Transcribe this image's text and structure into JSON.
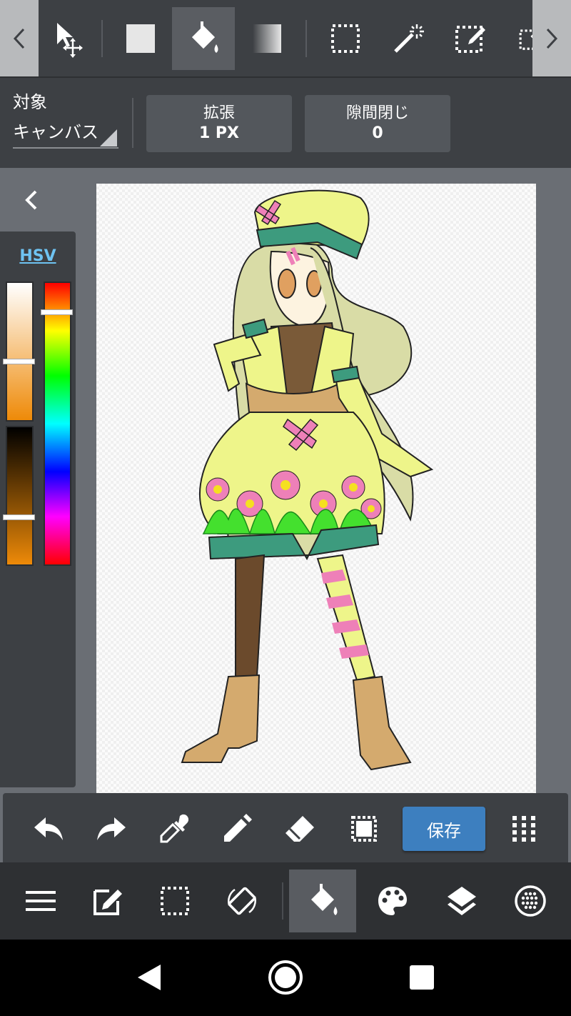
{
  "top_toolbar": {
    "tools": [
      "move-tool",
      "fill-color-tool",
      "bucket-fill-tool",
      "gradient-tool",
      "select-rect-tool",
      "magic-wand-tool",
      "select-pen-tool",
      "select-eraser-tool"
    ],
    "active_tool": "bucket-fill-tool"
  },
  "options": {
    "target_label": "対象",
    "target_value": "キャンバス",
    "expand_label": "拡張",
    "expand_value": "1 PX",
    "gap_close_label": "隙間閉じ",
    "gap_close_value": "0"
  },
  "color_panel": {
    "mode_label": "HSV",
    "current_color": "#ee8a08"
  },
  "action_bar": {
    "save_label": "保存"
  },
  "main_bar": {
    "active": "bucket-fill"
  },
  "colors": {
    "toolbar_bg": "#3d4044",
    "accent": "#3d7fbf",
    "hsv_link": "#6ec3f2"
  }
}
